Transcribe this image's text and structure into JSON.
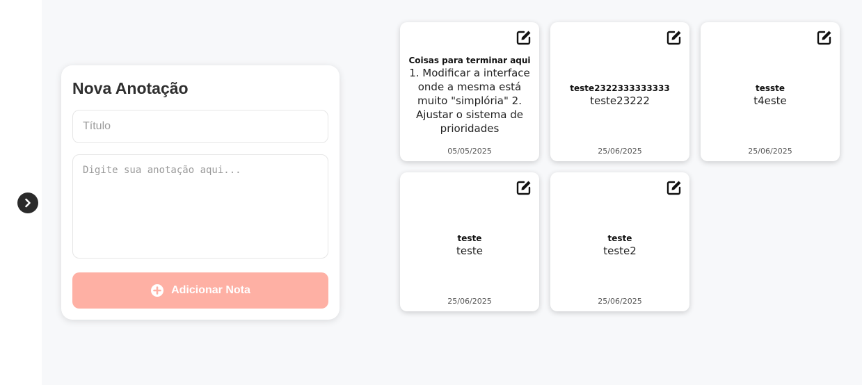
{
  "form": {
    "heading": "Nova Anotação",
    "title_placeholder": "Título",
    "content_placeholder": "Digite sua anotação aqui...",
    "add_button_label": "Adicionar Nota",
    "add_button_color": "#feb0a4"
  },
  "sidebar": {
    "toggle_icon": "chevron-right-icon"
  },
  "notes": [
    {
      "title": "Coisas para terminar aqui",
      "content": "1. Modificar a interface onde a mesma está muito \"simplória\" 2. Ajustar o sistema de prioridades",
      "date": "05/05/2025"
    },
    {
      "title": "teste2322333333333",
      "content": "teste23222",
      "date": "25/06/2025"
    },
    {
      "title": "tesste",
      "content": "t4este",
      "date": "25/06/2025"
    },
    {
      "title": "teste",
      "content": "teste",
      "date": "25/06/2025"
    },
    {
      "title": "teste",
      "content": "teste2",
      "date": "25/06/2025"
    }
  ]
}
